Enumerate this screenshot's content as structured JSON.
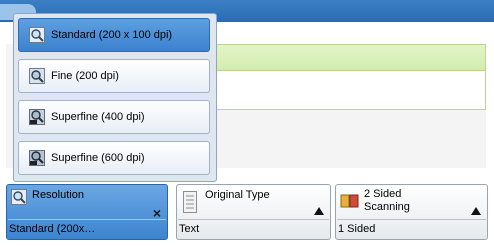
{
  "dropdown": {
    "options": [
      {
        "label": "Standard (200 x 100 dpi)",
        "icon": "magnifier-standard-icon",
        "selected": true
      },
      {
        "label": "Fine (200 dpi)",
        "icon": "magnifier-fine-icon",
        "selected": false
      },
      {
        "label": "Superfine (400 dpi)",
        "icon": "magnifier-400-icon",
        "selected": false
      },
      {
        "label": "Superfine (600 dpi)",
        "icon": "magnifier-600-icon",
        "selected": false
      }
    ]
  },
  "tiles": {
    "resolution": {
      "label": "Resolution",
      "value": "Standard (200x…",
      "close": "×"
    },
    "original_type": {
      "label": "Original Type",
      "value": "Text"
    },
    "two_sided": {
      "label": "2 Sided Scanning",
      "value": "1 Sided"
    }
  },
  "colors": {
    "accent": "#3b82cf",
    "title_bar": "#2a6cb3",
    "green_bar": "#d2ecac"
  }
}
